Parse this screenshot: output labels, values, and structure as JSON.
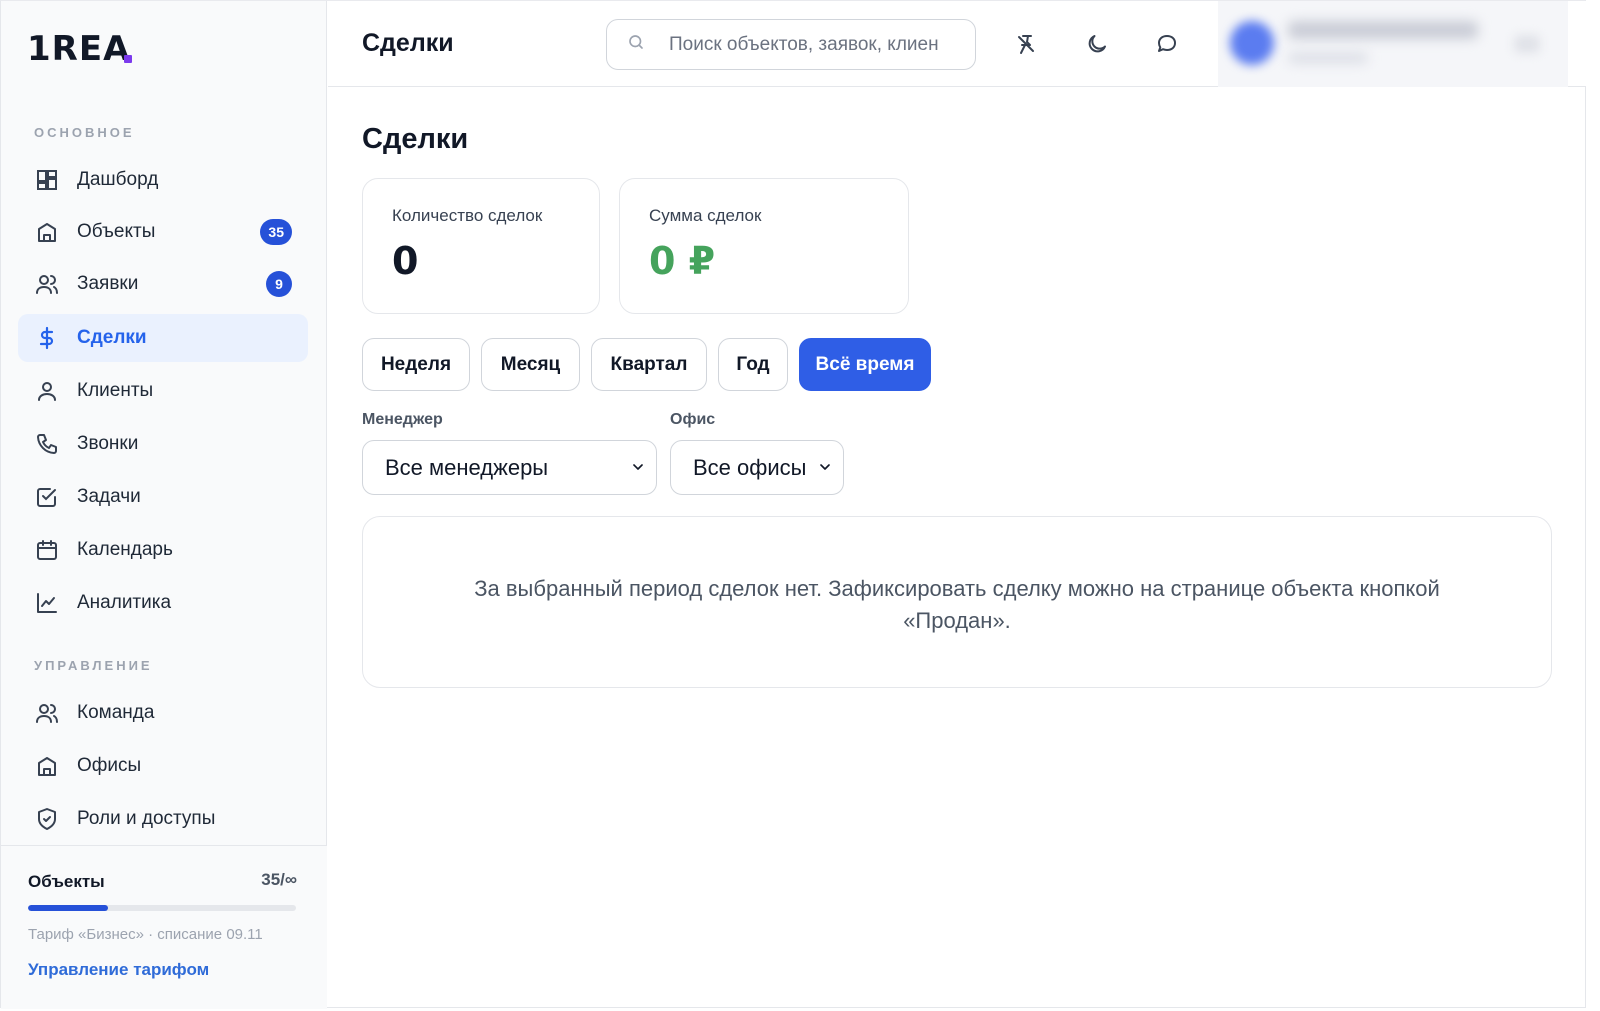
{
  "app": {
    "logo_text": "1REA"
  },
  "sidebar": {
    "sections": [
      {
        "label": "ОСНОВНОЕ"
      },
      {
        "label": "УПРАВЛЕНИЕ"
      }
    ],
    "main_items": [
      {
        "label": "Дашборд",
        "icon": "dashboard-icon"
      },
      {
        "label": "Объекты",
        "icon": "building-icon",
        "badge": "35"
      },
      {
        "label": "Заявки",
        "icon": "users-icon",
        "badge": "9"
      },
      {
        "label": "Сделки",
        "icon": "dollar-icon",
        "active": true
      },
      {
        "label": "Клиенты",
        "icon": "user-icon"
      },
      {
        "label": "Звонки",
        "icon": "phone-icon"
      },
      {
        "label": "Задачи",
        "icon": "checkbox-icon"
      },
      {
        "label": "Календарь",
        "icon": "calendar-icon"
      },
      {
        "label": "Аналитика",
        "icon": "chart-icon"
      }
    ],
    "admin_items": [
      {
        "label": "Команда",
        "icon": "users-icon"
      },
      {
        "label": "Офисы",
        "icon": "building-icon"
      },
      {
        "label": "Роли и доступы",
        "icon": "shield-icon"
      }
    ],
    "footer": {
      "quota_title": "Объекты",
      "quota_count": "35/∞",
      "quota_fill_fraction": 0.3,
      "tariff_text": "Тариф «Бизнес» · списание 09.11",
      "manage_link": "Управление тарифом"
    }
  },
  "header": {
    "title": "Сделки",
    "search_placeholder": "Поиск объектов, заявок, клиентов"
  },
  "main": {
    "title": "Сделки",
    "stats": [
      {
        "label": "Количество сделок",
        "value": "0"
      },
      {
        "label": "Сумма сделок",
        "value": "0 ₽"
      }
    ],
    "periods": [
      {
        "label": "Неделя"
      },
      {
        "label": "Месяц"
      },
      {
        "label": "Квартал"
      },
      {
        "label": "Год"
      },
      {
        "label": "Всё время",
        "active": true
      }
    ],
    "filters": {
      "manager_label": "Менеджер",
      "manager_value": "Все менеджеры",
      "office_label": "Офис",
      "office_value": "Все офисы"
    },
    "empty_message": "За выбранный период сделок нет. Зафиксировать сделку можно на странице объекта кнопкой «Продан»."
  },
  "colors": {
    "accent": "#2f5ee6",
    "badge": "#2651d8",
    "active_nav_bg": "#eaf1fe",
    "sum_green": "#45a35c",
    "link": "#2f6bd8"
  }
}
